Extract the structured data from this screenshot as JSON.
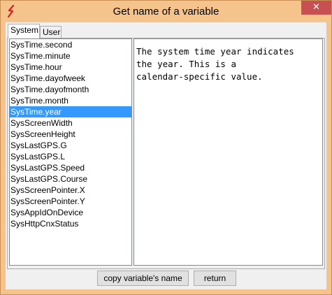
{
  "window": {
    "title": "Get name of a variable",
    "close_glyph": "✕"
  },
  "tabs": [
    {
      "label": "System",
      "active": true
    },
    {
      "label": "User",
      "active": false
    }
  ],
  "variables": [
    "SysTime.second",
    "SysTime.minute",
    "SysTime.hour",
    "SysTime.dayofweek",
    "SysTime.dayofmonth",
    "SysTime.month",
    "SysTime.year",
    "SysScreenWidth",
    "SysScreenHeight",
    "SysLastGPS.G",
    "SysLastGPS.L",
    "SysLastGPS.Speed",
    "SysLastGPS.Course",
    "SysScreenPointer.X",
    "SysScreenPointer.Y",
    "SysAppIdOnDevice",
    "SysHttpCnxStatus"
  ],
  "selected_variable": "SysTime.year",
  "description": "The system time year indicates\nthe year. This is a\ncalendar-specific value.",
  "buttons": {
    "copy_label": "copy variable's name",
    "return_label": "return"
  },
  "colors": {
    "titlebar": "#f5c48d",
    "selection": "#3399ff",
    "close": "#c75050"
  },
  "icons": {
    "app": "app-logo-icon",
    "close": "close-icon"
  }
}
